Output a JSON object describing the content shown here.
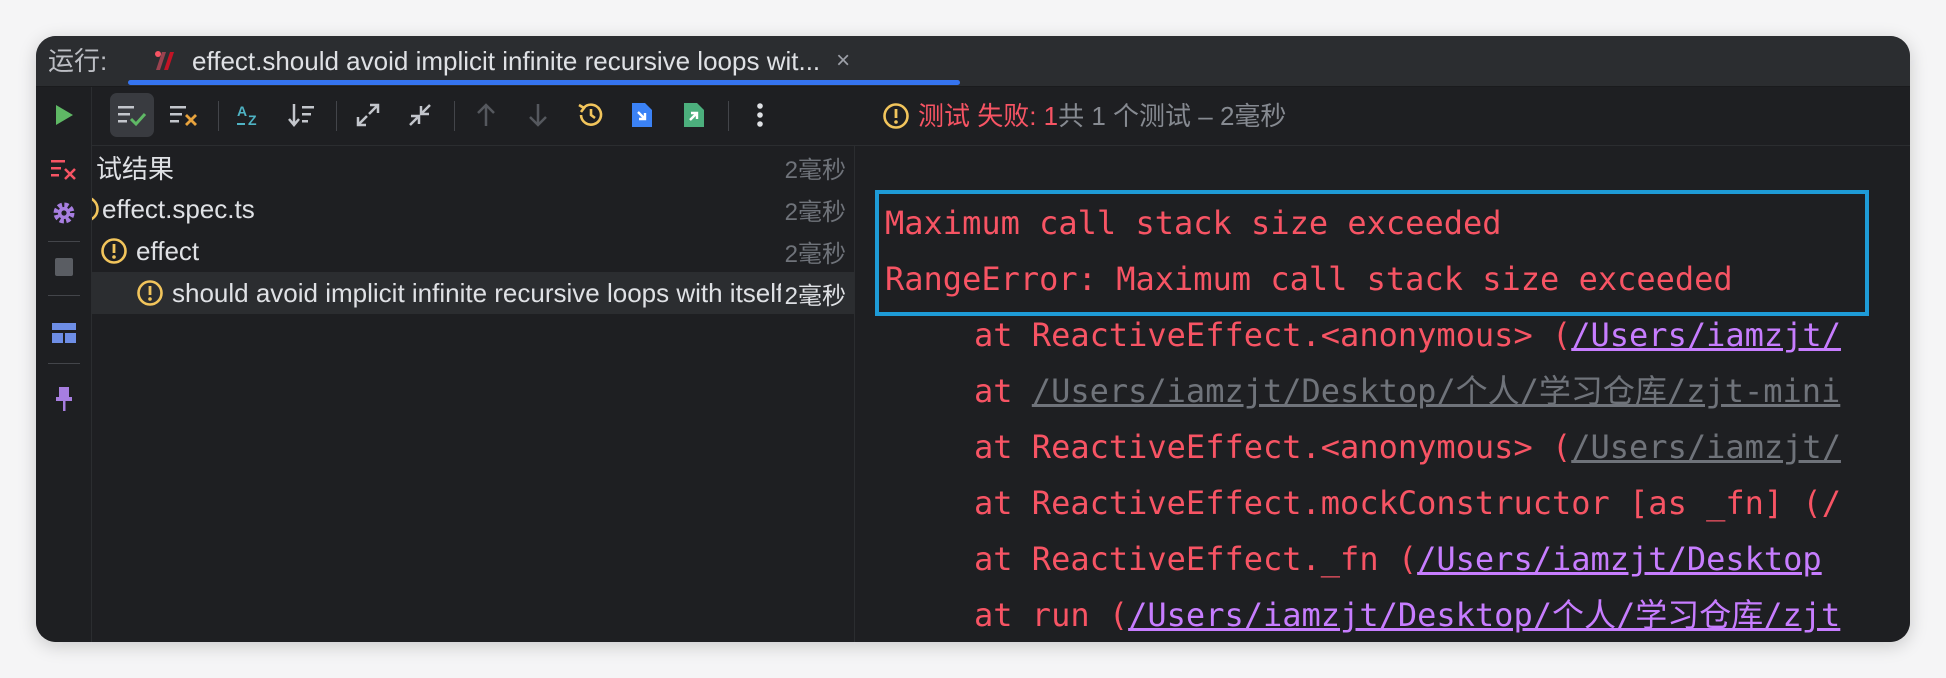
{
  "titlebar": {
    "run_label": "运行:",
    "tab_title": "effect.should avoid implicit infinite recursive loops wit...",
    "tab_close": "×"
  },
  "toolbar": {
    "status_failed": "测试 失败: 1",
    "status_summary": "共 1 个测试 – 2毫秒"
  },
  "tree": {
    "rows": [
      {
        "label": "试结果",
        "time": "2毫秒"
      },
      {
        "label": "effect.spec.ts",
        "time": "2毫秒"
      },
      {
        "label": "effect",
        "time": "2毫秒"
      },
      {
        "label": "should avoid implicit infinite recursive loops with itself",
        "time": "2毫秒"
      }
    ]
  },
  "console": {
    "error_line_1": "Maximum call stack size exceeded",
    "error_line_2": "RangeError: Maximum call stack size exceeded",
    "stack": [
      {
        "prefix": "at ReactiveEffect.<anonymous> (",
        "link": "/Users/iamzjt/",
        "dim": false
      },
      {
        "prefix": "at ",
        "link": "/Users/iamzjt/Desktop/个人/学习仓库/zjt-mini",
        "dim": true
      },
      {
        "prefix": "at ReactiveEffect.<anonymous> (",
        "link": "/Users/iamzjt/",
        "dim": true
      },
      {
        "prefix": "at ReactiveEffect.mockConstructor [as _fn] (/",
        "link": "",
        "dim": false
      },
      {
        "prefix": "at ReactiveEffect._fn (",
        "link": "/Users/iamzjt/Desktop",
        "dim": false
      },
      {
        "prefix": "at run (",
        "link": "/Users/iamzjt/Desktop/个人/学习仓库/zjt",
        "dim": false
      }
    ]
  },
  "colors": {
    "error_red": "#f75464",
    "warning_yellow": "#f2c55c",
    "link_purple": "#c77dff",
    "highlight_box": "#1e9bd7",
    "tab_underline": "#3574f0"
  }
}
